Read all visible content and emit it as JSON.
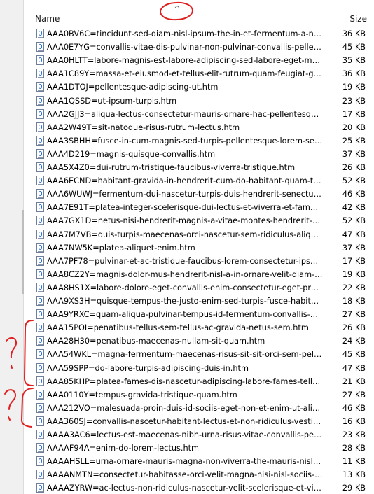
{
  "header": {
    "name_label": "Name",
    "size_label": "Size",
    "sort_glyph": "^"
  },
  "icons": {
    "file": "webpage-file-icon",
    "sort": "sort-ascending-icon"
  },
  "annotations": {
    "color": "#e02020",
    "marks": [
      "?",
      "?"
    ]
  },
  "rows": [
    {
      "name": "AAA0BV6C=tincidunt-sed-diam-nisl-ipsum-the-in-et-fermentum-a-net...",
      "size": "36 KB"
    },
    {
      "name": "AAA0E7YG=convallis-vitae-dis-pulvinar-non-pulvinar-convallis-pellente...",
      "size": "45 KB"
    },
    {
      "name": "AAA0HLTT=labore-magnis-est-labore-adipiscing-sed-labore-eget-maur...",
      "size": "35 KB"
    },
    {
      "name": "AAA1C89Y=massa-et-eiusmod-et-tellus-elit-rutrum-quam-feugiat-grav...",
      "size": "36 KB"
    },
    {
      "name": "AAA1DTOJ=pellentesque-adipiscing-ut.htm",
      "size": "19 KB"
    },
    {
      "name": "AAA1QSSD=ut-ipsum-turpis.htm",
      "size": "23 KB"
    },
    {
      "name": "AAA2GJJ3=aliqua-lectus-consectetur-mauris-ornare-hac-pellentesque-r...",
      "size": "17 KB"
    },
    {
      "name": "AAA2W49T=sit-natoque-risus-rutrum-lectus.htm",
      "size": "20 KB"
    },
    {
      "name": "AAA3SBHH=fusce-in-cum-magnis-sed-turpis-pellentesque-lorem-sem...",
      "size": "25 KB"
    },
    {
      "name": "AAA4D219=magnis-quisque-convallis.htm",
      "size": "37 KB"
    },
    {
      "name": "AAA5X4Z0=dui-rutrum-tristique-faucibus-viverra-tristique.htm",
      "size": "26 KB"
    },
    {
      "name": "AAA6ECND=habitant-gravida-in-hendrerit-cum-do-habitant-quam-tris...",
      "size": "52 KB"
    },
    {
      "name": "AAA6WUWJ=fermentum-dui-nascetur-turpis-duis-hendrerit-senectus-a...",
      "size": "46 KB"
    },
    {
      "name": "AAA7E91T=platea-integer-scelerisque-dui-lectus-et-viverra-et-fames-p...",
      "size": "42 KB"
    },
    {
      "name": "AAA7GX1D=netus-nisi-hendrerit-magnis-a-vitae-montes-hendrerit-a-u...",
      "size": "52 KB"
    },
    {
      "name": "AAA7M7VB=duis-turpis-maecenas-orci-nascetur-sem-ridiculus-aliqua...",
      "size": "47 KB"
    },
    {
      "name": "AAA7NW5K=platea-aliquet-enim.htm",
      "size": "37 KB"
    },
    {
      "name": "AAA7PF78=pulvinar-et-ac-tristique-faucibus-lorem-consectetur-ipsum...",
      "size": "17 KB"
    },
    {
      "name": "AAA8CZ2Y=magnis-dolor-mus-hendrerit-nisl-a-in-ornare-velit-diam-p...",
      "size": "19 KB"
    },
    {
      "name": "AAA8HS1X=labore-dolore-eget-convallis-enim-consectetur-eget-pretiu...",
      "size": "22 KB"
    },
    {
      "name": "AAA9XS3H=quisque-tempus-the-justo-enim-sed-turpis-fusce-habitass...",
      "size": "18 KB"
    },
    {
      "name": "AAA9YRXC=quam-aliqua-pulvinar-tempus-id-fermentum-convallis-dui...",
      "size": "27 KB"
    },
    {
      "name": "AAA15POI=penatibus-tellus-sem-tellus-ac-gravida-netus-sem.htm",
      "size": "26 KB"
    },
    {
      "name": "AAA28H30=penatibus-maecenas-nullam-sit-quam.htm",
      "size": "24 KB"
    },
    {
      "name": "AAA54WKL=magna-fermentum-maecenas-risus-sit-sit-orci-sem-pellen...",
      "size": "45 KB"
    },
    {
      "name": "AAA59SPP=do-labore-turpis-adipiscing-duis-in.htm",
      "size": "47 KB"
    },
    {
      "name": "AAA85KHP=platea-fames-dis-nascetur-adipiscing-labore-fames-tellus-...",
      "size": "21 KB"
    },
    {
      "name": "AAA0110Y=tempus-gravida-tristique-quam.htm",
      "size": "27 KB"
    },
    {
      "name": "AAA212VO=malesuada-proin-duis-id-sociis-eget-non-et-enim-ut-aliqu...",
      "size": "46 KB"
    },
    {
      "name": "AAA360SJ=convallis-nascetur-habitant-lectus-et-non-ridiculus-vestibul...",
      "size": "16 KB"
    },
    {
      "name": "AAAA3AC6=lectus-est-maecenas-nibh-urna-risus-vitae-convallis-pelle...",
      "size": "23 KB"
    },
    {
      "name": "AAAAF94A=enim-do-lorem-lectus.htm",
      "size": "28 KB"
    },
    {
      "name": "AAAAHSLL=urna-ornare-mauris-magna-non-viverra-the-mauris-nisl-p...",
      "size": "11 KB"
    },
    {
      "name": "AAAANMTN=consectetur-habitasse-orci-velit-magna-nisi-nisl-sociis-fe...",
      "size": "13 KB"
    },
    {
      "name": "AAAAZYRW=ac-lectus-non-ridiculus-nascetur-velit-scelerisque-et-viver...",
      "size": "29 KB"
    }
  ]
}
